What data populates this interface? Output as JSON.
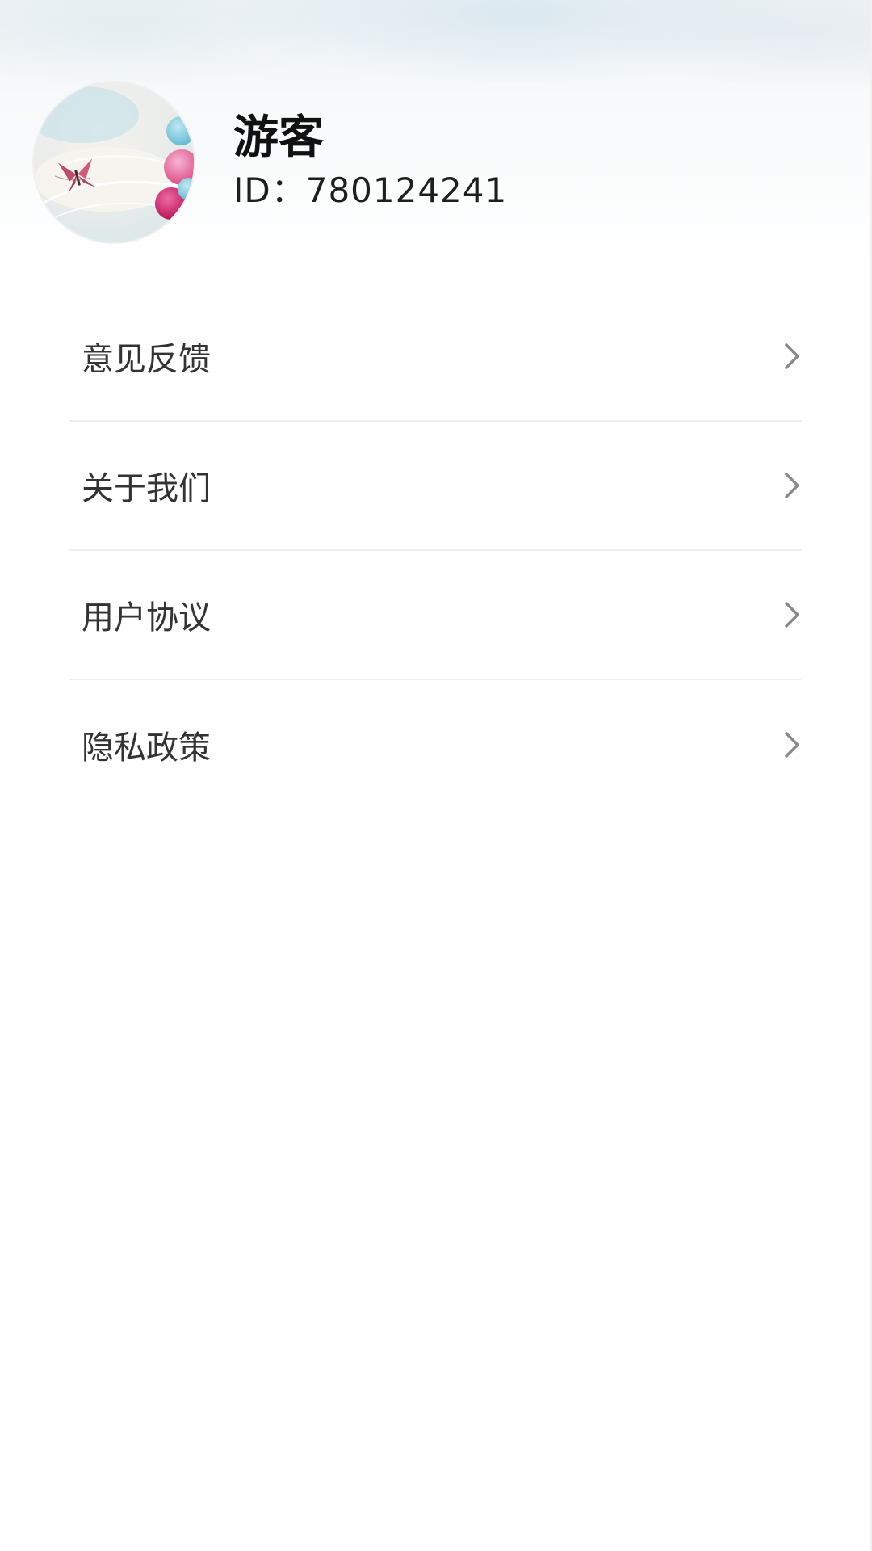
{
  "profile": {
    "avatar_icon": "avatar-balloons-butterfly-image",
    "name": "游客",
    "id_text": "ID：780124241"
  },
  "menu": {
    "items": [
      {
        "label": "意见反馈",
        "icon": "chevron-right-icon"
      },
      {
        "label": "关于我们",
        "icon": "chevron-right-icon"
      },
      {
        "label": "用户协议",
        "icon": "chevron-right-icon"
      },
      {
        "label": "隐私政策",
        "icon": "chevron-right-icon"
      }
    ]
  },
  "colors": {
    "text_primary": "#111111",
    "text_menu": "#333333",
    "chevron": "#8a8a8a",
    "divider": "#eeeeee",
    "header_tint": "#eef3f5"
  }
}
